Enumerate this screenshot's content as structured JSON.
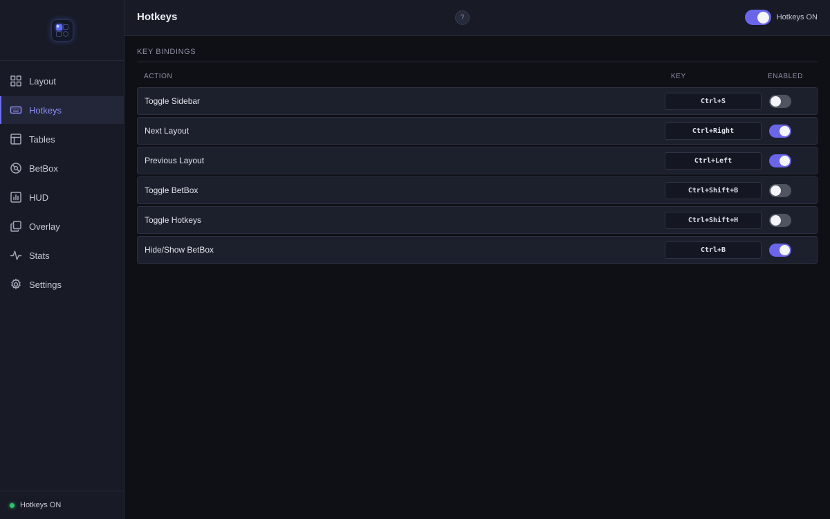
{
  "sidebar": {
    "items": [
      {
        "label": "Layout",
        "icon": "layout-grid-icon",
        "active": false
      },
      {
        "label": "Hotkeys",
        "icon": "keyboard-icon",
        "active": true
      },
      {
        "label": "Tables",
        "icon": "table-icon",
        "active": false
      },
      {
        "label": "BetBox",
        "icon": "chip-icon",
        "active": false
      },
      {
        "label": "HUD",
        "icon": "bar-chart-icon",
        "active": false
      },
      {
        "label": "Overlay",
        "icon": "overlay-icon",
        "active": false
      },
      {
        "label": "Stats",
        "icon": "activity-icon",
        "active": false
      },
      {
        "label": "Settings",
        "icon": "gear-icon",
        "active": false
      }
    ],
    "footer_status": "Hotkeys ON"
  },
  "header": {
    "title": "Hotkeys",
    "help_label": "?",
    "toggle_label": "Hotkeys ON",
    "toggle_on": true
  },
  "bindings": {
    "section_title": "KEY BINDINGS",
    "columns": {
      "action": "ACTION",
      "key": "KEY",
      "enabled": "ENABLED"
    },
    "rows": [
      {
        "action": "Toggle Sidebar",
        "key": "Ctrl+S",
        "enabled": false
      },
      {
        "action": "Next Layout",
        "key": "Ctrl+Right",
        "enabled": true
      },
      {
        "action": "Previous Layout",
        "key": "Ctrl+Left",
        "enabled": true
      },
      {
        "action": "Toggle BetBox",
        "key": "Ctrl+Shift+B",
        "enabled": false
      },
      {
        "action": "Toggle Hotkeys",
        "key": "Ctrl+Shift+H",
        "enabled": false
      },
      {
        "action": "Hide/Show BetBox",
        "key": "Ctrl+B",
        "enabled": true
      }
    ]
  },
  "colors": {
    "accent": "#6a66ec",
    "status_green": "#27c56b",
    "background": "#0f1016",
    "sidebar": "#181b26"
  }
}
